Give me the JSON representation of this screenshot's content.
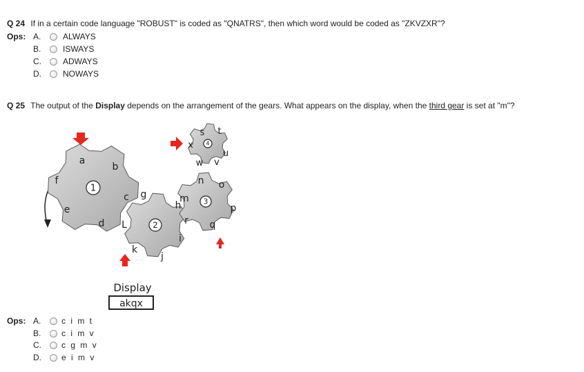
{
  "q24": {
    "number": "Q 24",
    "text": "If in a certain code language \"ROBUST\" is coded as \"QNATRS\", then which word would be coded as \"ZKVZXR\"?",
    "ops_label": "Ops:",
    "options": [
      {
        "letter": "A.",
        "text": "ALWAYS"
      },
      {
        "letter": "B.",
        "text": "ISWAYS"
      },
      {
        "letter": "C.",
        "text": "ADWAYS"
      },
      {
        "letter": "D.",
        "text": "NOWAYS"
      }
    ]
  },
  "q25": {
    "number": "Q 25",
    "text_1": "The output of the ",
    "text_bold": "Display",
    "text_2": " depends on the arrangement of the gears. What appears on the display, when the ",
    "text_under": "third gear",
    "text_3": " is set at \"m\"?",
    "ops_label": "Ops:",
    "options": [
      {
        "letter": "A.",
        "text": "c i m t"
      },
      {
        "letter": "B.",
        "text": "c i m v"
      },
      {
        "letter": "C.",
        "text": "c g m v"
      },
      {
        "letter": "D.",
        "text": "e i m v"
      }
    ]
  },
  "figure": {
    "gear1": {
      "number": "1",
      "letters": [
        "a",
        "b",
        "c",
        "d",
        "e",
        "f"
      ]
    },
    "gear2": {
      "number": "2",
      "letters": [
        "g",
        "h",
        "i",
        "j",
        "k",
        "L"
      ]
    },
    "gear3": {
      "number": "3",
      "letters": [
        "m",
        "n",
        "o",
        "p",
        "q",
        "r"
      ]
    },
    "gear4": {
      "number": "4",
      "letters": [
        "s",
        "t",
        "u",
        "v",
        "w",
        "x"
      ]
    },
    "display_label": "Display",
    "display_value": "akqx",
    "colors": {
      "gear": "#c9c9c9",
      "arrow": "#e8261e",
      "outline": "#5a5a5a"
    }
  }
}
